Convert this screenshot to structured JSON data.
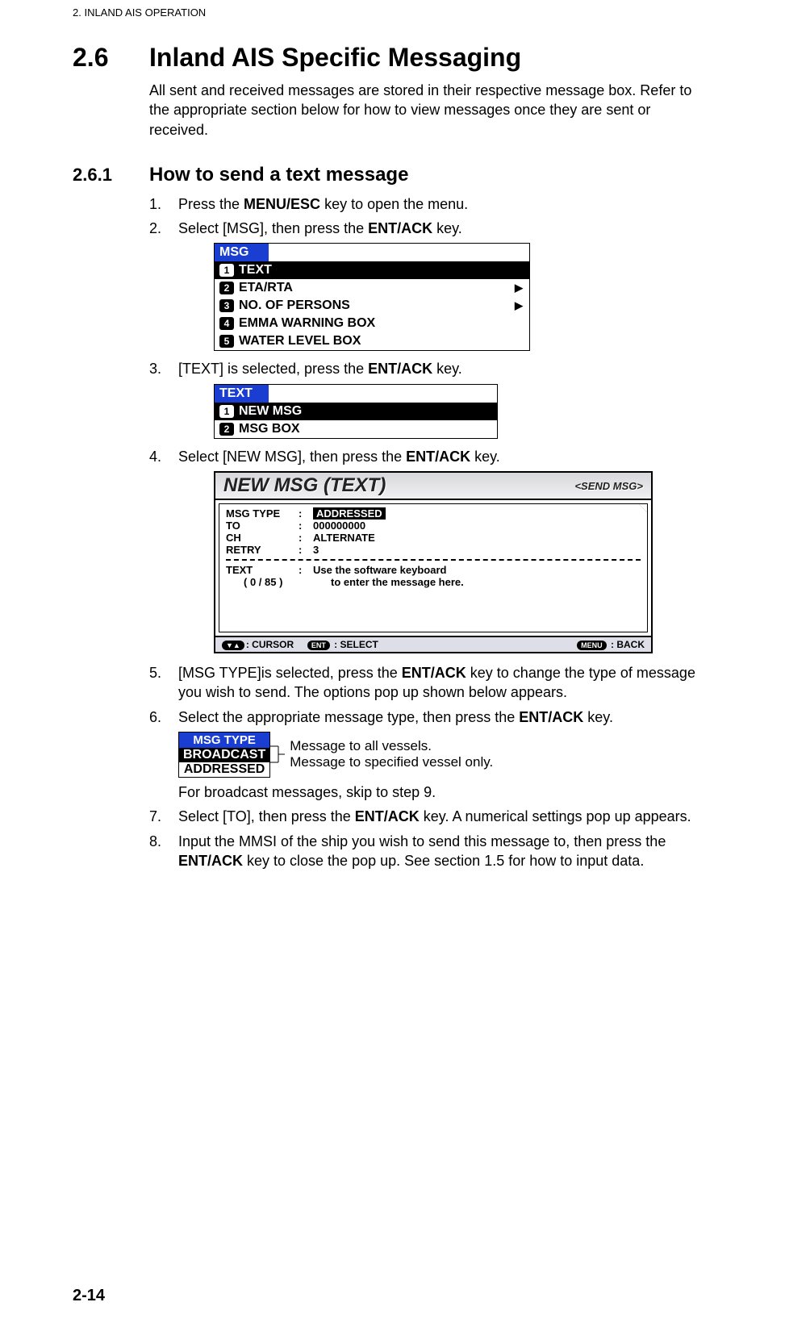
{
  "header": "2.  INLAND AIS OPERATION",
  "section": {
    "num": "2.6",
    "title": "Inland AIS Specific Messaging"
  },
  "intro": "All sent and received messages are stored in their respective message box. Refer to the appropriate section below for how to view messages once they are sent or received.",
  "subsection": {
    "num": "2.6.1",
    "title": "How to send a text message"
  },
  "steps": {
    "s1_a": "Press the ",
    "s1_b": "MENU/ESC",
    "s1_c": " key to open the menu.",
    "s2_a": "Select [MSG], then press the ",
    "s2_b": "ENT/ACK",
    "s2_c": " key.",
    "s3_a": "[TEXT] is selected, press the ",
    "s3_b": "ENT/ACK",
    "s3_c": " key.",
    "s4_a": "Select [NEW MSG], then press the ",
    "s4_b": "ENT/ACK",
    "s4_c": " key.",
    "s5_a": "[MSG TYPE]is selected, press the ",
    "s5_b": "ENT/ACK",
    "s5_c": " key to change the type of message you wish to send. The options pop up shown below appears.",
    "s6_a": "Select the appropriate message type, then press the ",
    "s6_b": "ENT/ACK",
    "s6_c": " key.",
    "s6_note": "For broadcast messages, skip to step 9.",
    "s7_a": "Select [TO], then press the ",
    "s7_b": "ENT/ACK",
    "s7_c": " key. A numerical settings pop up appears.",
    "s8_a": "Input the MMSI of the ship you wish to send this message to, then press the ",
    "s8_b": "ENT/ACK",
    "s8_c": " key to close the pop up. See section 1.5 for how to input data."
  },
  "msg_menu": {
    "title": "MSG",
    "items": [
      {
        "idx": "1",
        "label": "TEXT",
        "selected": true,
        "arrow": false
      },
      {
        "idx": "2",
        "label": "ETA/RTA",
        "selected": false,
        "arrow": true
      },
      {
        "idx": "3",
        "label": "NO. OF PERSONS",
        "selected": false,
        "arrow": true
      },
      {
        "idx": "4",
        "label": "EMMA WARNING BOX",
        "selected": false,
        "arrow": false
      },
      {
        "idx": "5",
        "label": "WATER LEVEL BOX",
        "selected": false,
        "arrow": false
      }
    ]
  },
  "text_menu": {
    "title": "TEXT",
    "items": [
      {
        "idx": "1",
        "label": "NEW MSG",
        "selected": true
      },
      {
        "idx": "2",
        "label": "MSG BOX",
        "selected": false
      }
    ]
  },
  "new_msg": {
    "title": "NEW MSG (TEXT)",
    "send": "<SEND MSG>",
    "rows": {
      "msgtype_l": "MSG TYPE",
      "msgtype_v": "ADDRESSED",
      "to_l": "TO",
      "to_v": "000000000",
      "ch_l": "CH",
      "ch_v": "ALTERNATE",
      "retry_l": "RETRY",
      "retry_v": "3",
      "text_l": "TEXT",
      "text_v1": "Use the software keyboard",
      "text_v2": "to enter the message here.",
      "counter": "(   0 / 85 )"
    },
    "footer": {
      "cursor": ": CURSOR",
      "ent": "ENT",
      "select": " : SELECT",
      "menu": "MENU",
      "back": " : BACK"
    }
  },
  "msg_type_popup": {
    "title": "MSG TYPE",
    "opt1": "BROADCAST",
    "opt2": "ADDRESSED",
    "note1": "Message to all vessels.",
    "note2": "Message to specified vessel only."
  },
  "page_num": "2-14"
}
